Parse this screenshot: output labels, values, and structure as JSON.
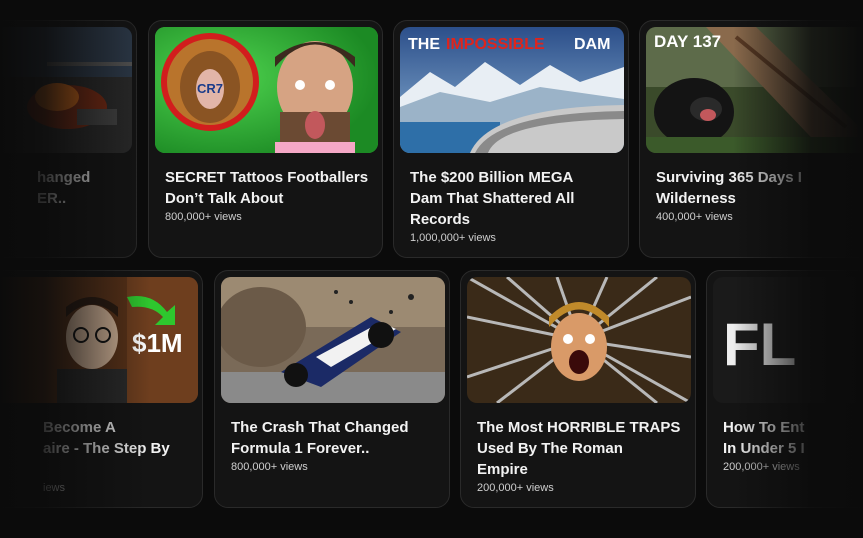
{
  "row1": [
    {
      "title_l1": "hanged",
      "title_l2": "ER..",
      "views": ""
    },
    {
      "title_l1": "SECRET Tattoos Footballers",
      "title_l2": "Don’t Talk About",
      "views": "800,000+ views",
      "overlay": "CR7"
    },
    {
      "title_l1": "The $200 Billion MEGA",
      "title_l2": "Dam That Shattered All",
      "title_l3": "Records",
      "views": "1,000,000+ views",
      "overlay_a": "THE",
      "overlay_b": "IMPOSSIBLE",
      "overlay_c": "DAM"
    },
    {
      "title_l1": "Surviving 365 Days I",
      "title_l2": "Wilderness",
      "views": "400,000+ views",
      "overlay": "DAY 137"
    }
  ],
  "row2": [
    {
      "title_l1": "Become A",
      "title_l2": "aire - The Step By",
      "views": "iews",
      "overlay": "$1M"
    },
    {
      "title_l1": "The Crash That Changed",
      "title_l2": "Formula 1 Forever..",
      "views": "800,000+ views"
    },
    {
      "title_l1": "The Most HORRIBLE TRAPS",
      "title_l2": "Used By The Roman",
      "title_l3": "Empire",
      "views": "200,000+ views"
    },
    {
      "title_l1": "How To Ent",
      "title_l2": "In Under 5 I",
      "views": "200,000+ views",
      "overlay": "FL"
    }
  ]
}
